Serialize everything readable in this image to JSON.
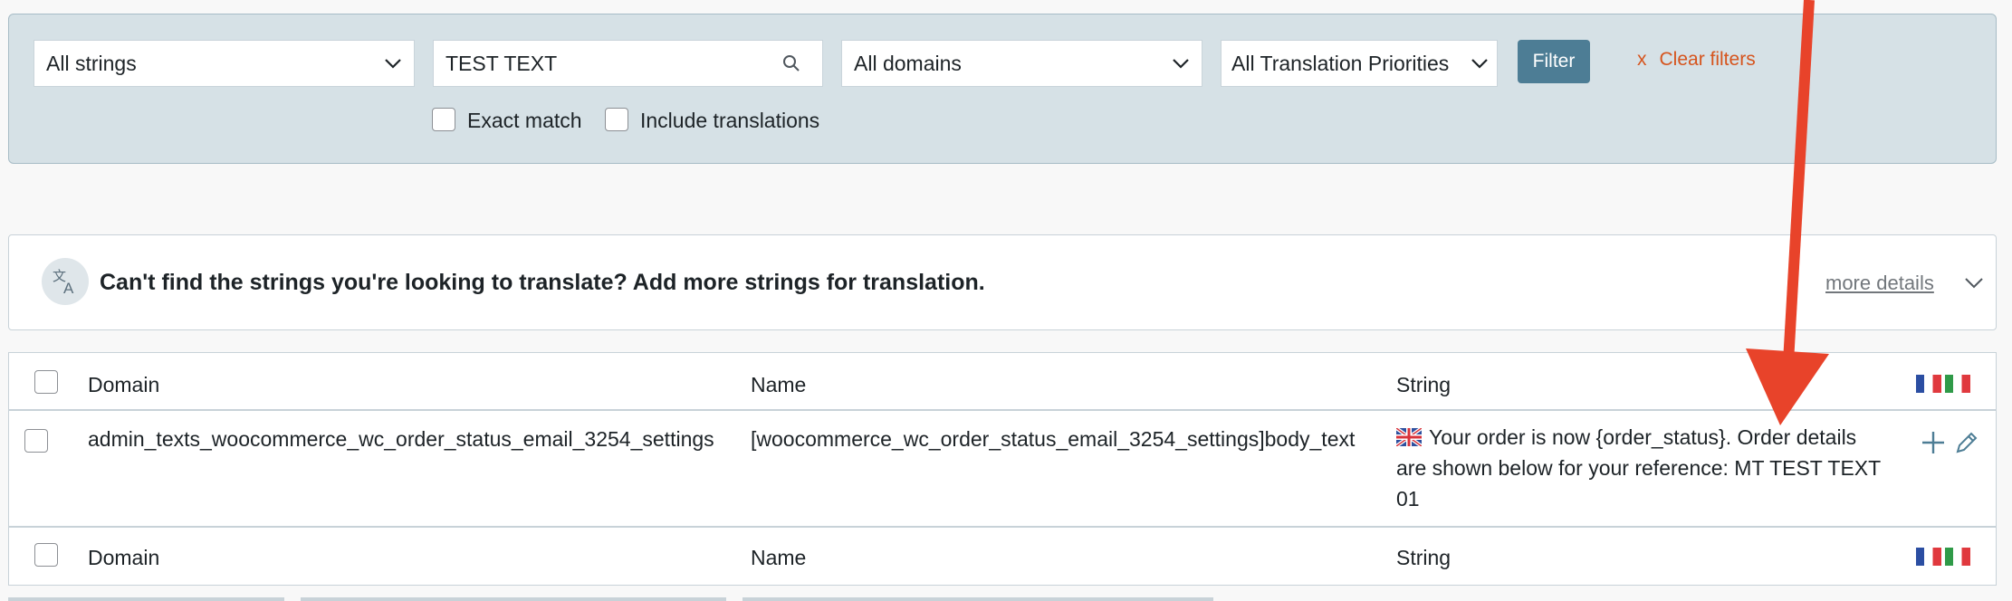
{
  "filters": {
    "string_select": "All strings",
    "search_value": "TEST TEXT",
    "domain_select": "All domains",
    "priority_select": "All Translation Priorities",
    "filter_button": "Filter",
    "clear_filters": "Clear filters",
    "clear_x": "x",
    "exact_match": "Exact match",
    "include_translations": "Include translations"
  },
  "notice": {
    "message": "Can't find the strings you're looking to translate? Add more strings for translation.",
    "more_details": "more details"
  },
  "table": {
    "headers": {
      "domain": "Domain",
      "name": "Name",
      "string": "String"
    },
    "rows": [
      {
        "domain": "admin_texts_woocommerce_wc_order_status_email_3254_settings",
        "name": "[woocommerce_wc_order_status_email_3254_settings]body_text",
        "string_line1": "Your order is now {order_status}. Order details",
        "string_line2": "are shown below for your reference: MT TEST TEXT",
        "string_line3": "01"
      }
    ],
    "footer": {
      "domain": "Domain",
      "name": "Name",
      "string": "String"
    }
  },
  "colors": {
    "filter_bg": "#d6e1e6",
    "filter_button": "#4d7d95",
    "clear_filters": "#d6541d",
    "arrow": "#e8432a"
  },
  "icons": [
    "chevron-down-icon",
    "search-icon",
    "translate-icon",
    "plus-icon",
    "pencil-icon",
    "flag-uk-icon",
    "language-flags-icon"
  ]
}
